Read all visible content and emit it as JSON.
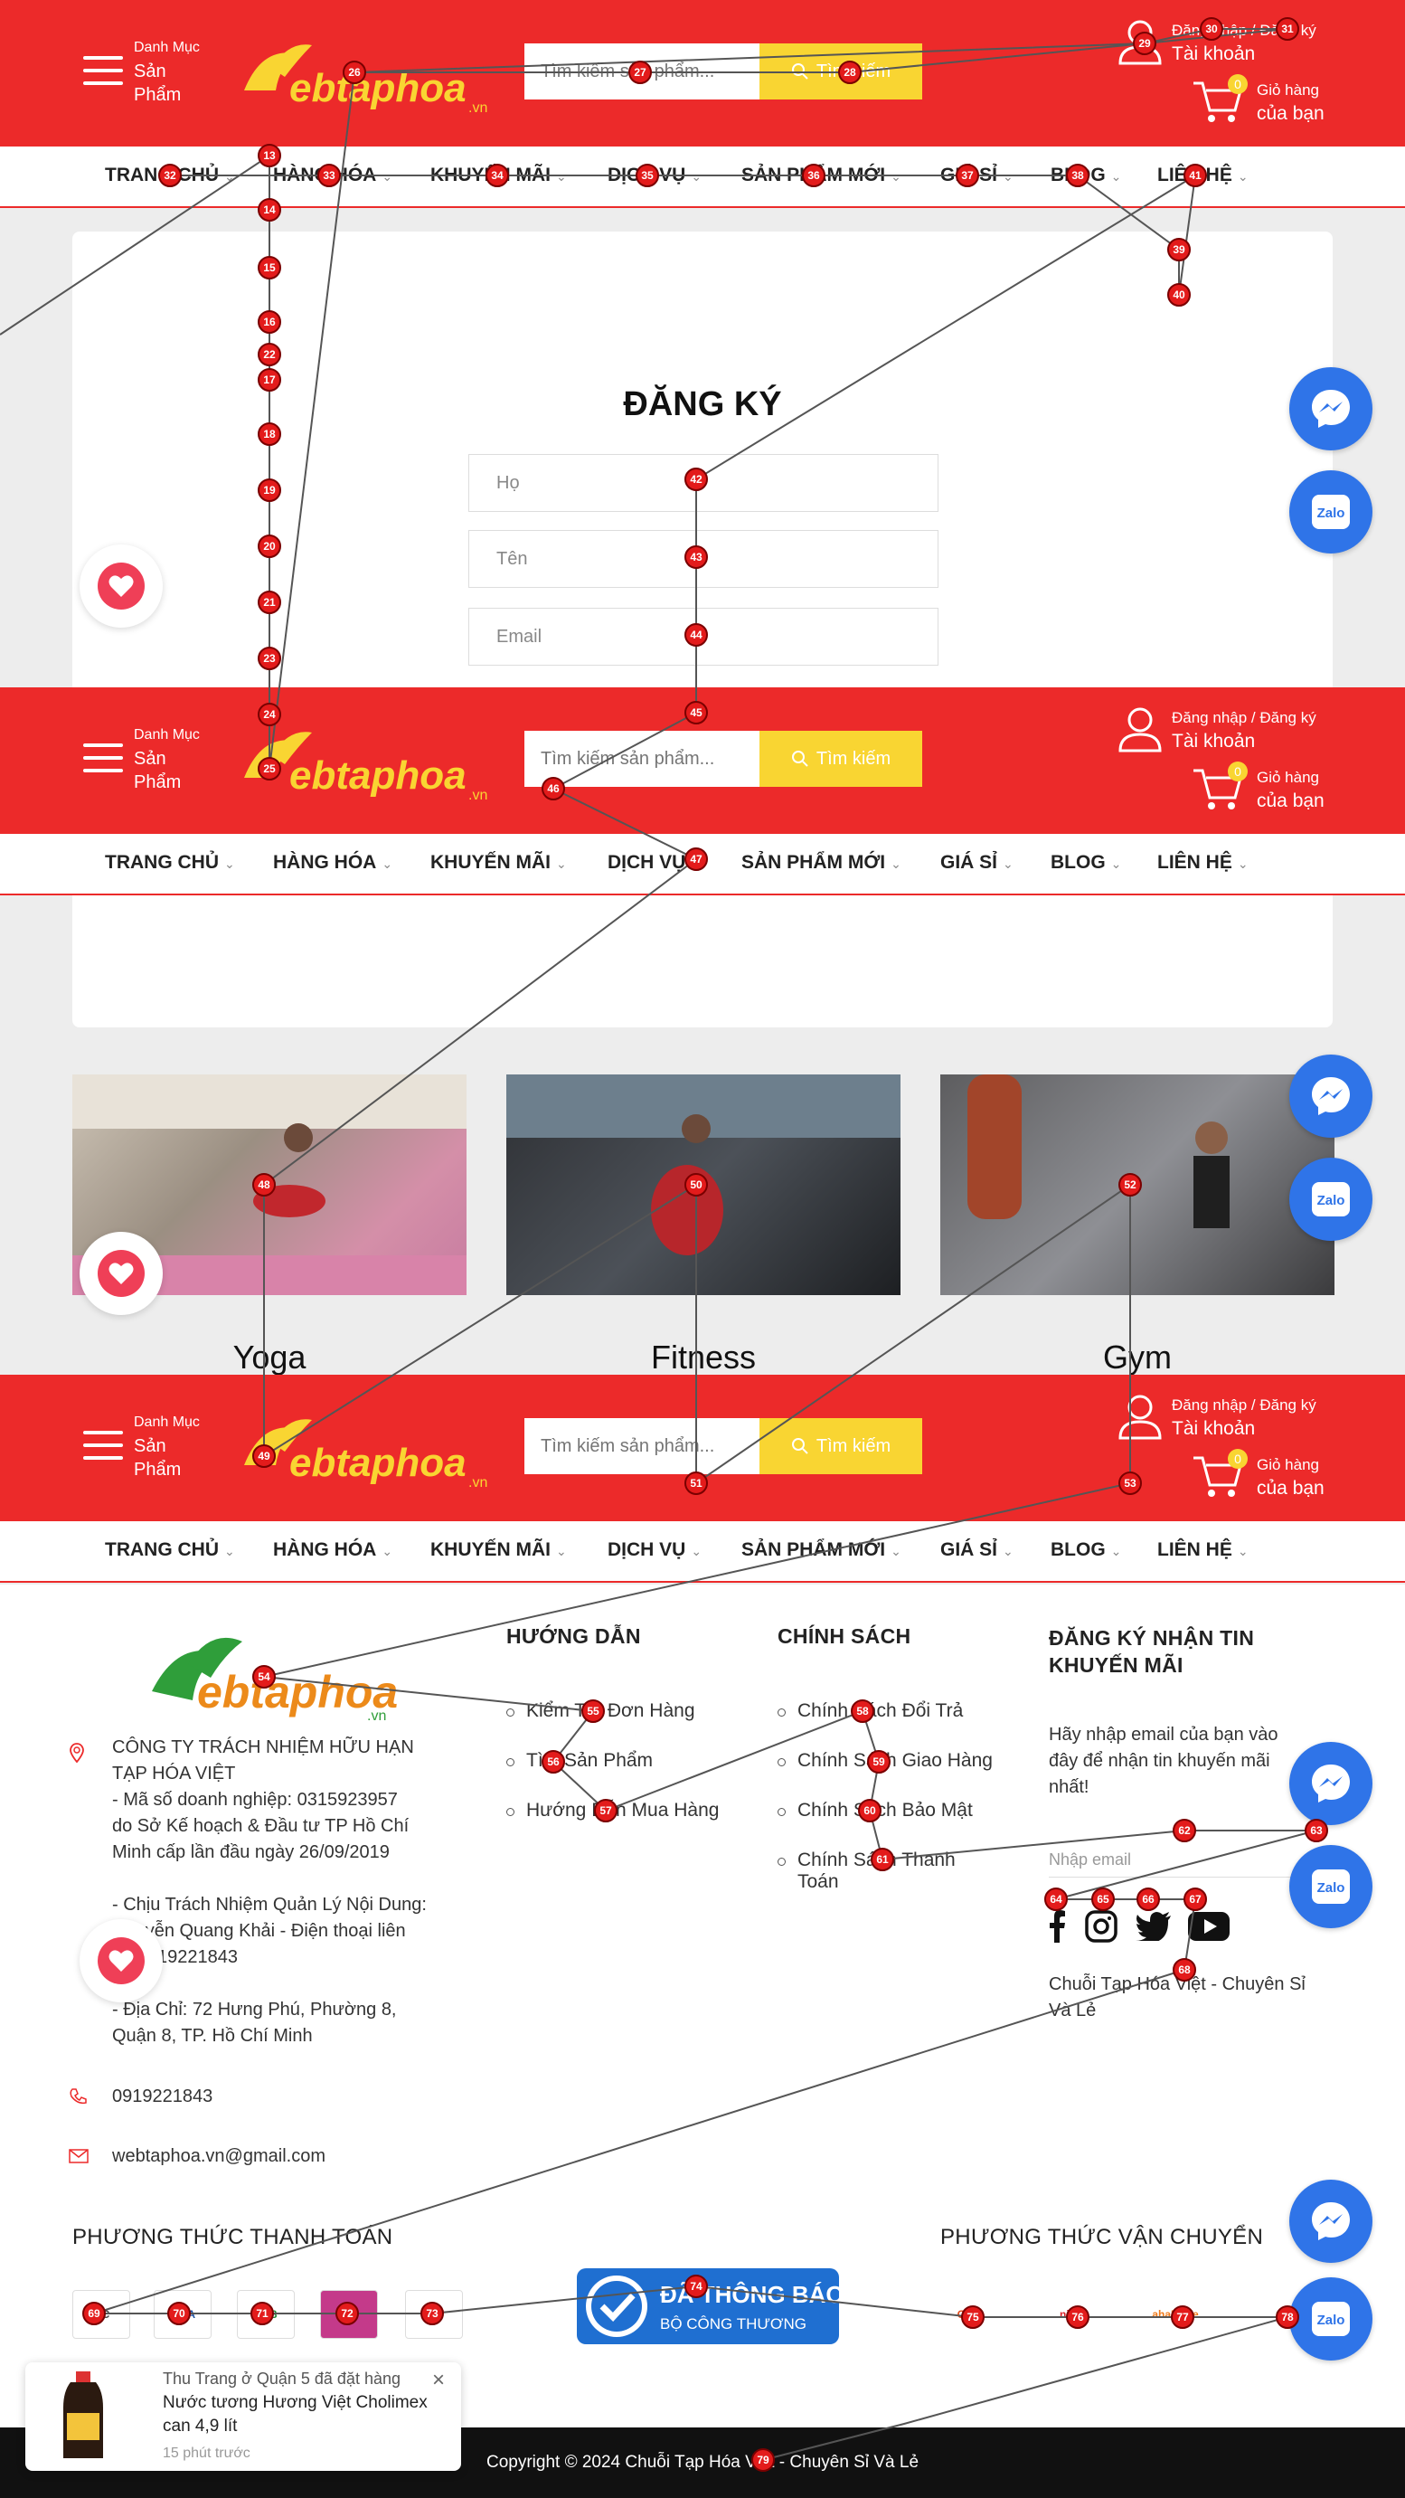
{
  "header": {
    "menu_line1": "Danh Mục",
    "menu_line2": "Sản",
    "menu_line3": "Phẩm",
    "search_placeholder": "Tìm kiếm sản phẩm...",
    "search_button": "Tìm kiếm",
    "account_line1": "Đăng nhập / Đăng ký",
    "account_line2": "Tài khoản",
    "cart_count": "0",
    "cart_line1": "Giỏ hàng",
    "cart_line2": "của bạn",
    "logo_text": "ebtaphoa",
    "logo_suffix": ".vn"
  },
  "nav": {
    "items": [
      "TRANG CHỦ",
      "HÀNG HÓA",
      "KHUYẾN MÃI",
      "DỊCH VỤ",
      "SẢN PHẨM MỚI",
      "GIÁ SỈ",
      "BLOG",
      "LIÊN HỆ"
    ]
  },
  "register": {
    "title": "ĐĂNG KÝ",
    "fields": [
      "Họ",
      "Tên",
      "Email"
    ]
  },
  "categories": [
    {
      "label": "Yoga"
    },
    {
      "label": "Fitness"
    },
    {
      "label": "Gym"
    }
  ],
  "footer": {
    "company_lines": [
      "CÔNG TY TRÁCH NHIỆM HỮU HẠN",
      "TẠP HÓA VIỆT",
      "- Mã số doanh nghiệp: 0315923957",
      "do Sở Kế hoạch & Đầu tư TP Hồ Chí",
      "Minh cấp lần đầu ngày 26/09/2019",
      "",
      "- Chịu Trách Nhiệm Quản Lý Nội Dung:",
      "Nguyễn Quang Khải - Điện thoại liên",
      "hệ 0919221843",
      "",
      "- Địa Chỉ: 72 Hưng Phú, Phường 8,",
      "Quận 8, TP. Hồ Chí Minh"
    ],
    "phone": "0919221843",
    "email": "webtaphoa.vn@gmail.com",
    "guide_title": "HƯỚNG DẪN",
    "guide_links": [
      "Kiểm Tra Đơn Hàng",
      "Tìm Sản Phẩm",
      "Hướng Dẫn Mua Hàng"
    ],
    "policy_title": "CHÍNH SÁCH",
    "policy_links": [
      "Chính Sách Đổi Trả",
      "Chính Sách Giao Hàng",
      "Chính Sách Bảo Mật",
      "Chính Sách Thanh",
      "Toán"
    ],
    "newsletter_title_1": "ĐĂNG KÝ NHẬN TIN",
    "newsletter_title_2": "KHUYẾN MÃI",
    "newsletter_desc": [
      "Hãy nhập email của bạn vào",
      "đây để nhận tin khuyến mãi",
      "nhất!"
    ],
    "newsletter_placeholder": "Nhập email",
    "slogan": [
      "Chuỗi Tạp Hóa Việt - Chuyên Sỉ",
      "Và Lẻ"
    ],
    "payment_title": "PHƯƠNG THỨC THANH TOÁN",
    "shipping_title": "PHƯƠNG THỨC VẬN CHUYỂN",
    "badge_line1": "ĐÃ THÔNG BÁO",
    "badge_line2": "BỘ CÔNG THƯƠNG",
    "copyright": "Copyright © 2024 Chuỗi Tạp Hóa Việt - Chuyên Sỉ Và Lẻ"
  },
  "toast": {
    "line1": "Thu Trang ở Quận 5 đã đặt hàng",
    "line2": "Nước tương Hương Việt Cholimex",
    "line3": "can 4,9 lít",
    "time": "15 phút trước"
  },
  "colors": {
    "brand_red": "#ec2a2a",
    "accent_yellow": "#f9d532",
    "messenger_blue": "#2f74e8"
  }
}
